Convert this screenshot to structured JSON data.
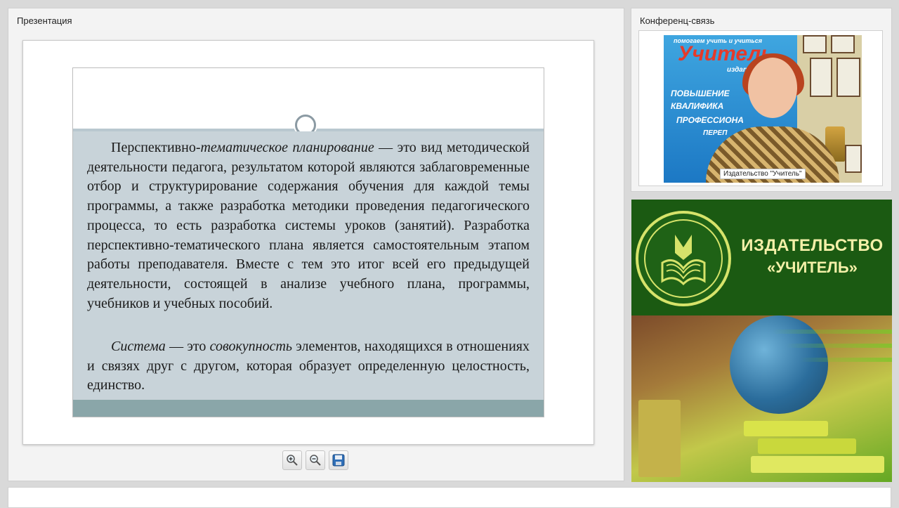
{
  "presentation": {
    "title": "Презентация",
    "slide": {
      "para1": [
        {
          "text": "Перспективно-",
          "italic": false
        },
        {
          "text": "тематическое планирование",
          "italic": true
        },
        {
          "text": " — это вид методической деятельности педагога, результатом которой являются заблаговременные отбор и структурирование содержания обучения для каждой темы программы, а также разработка методики проведения педагогического процесса, то есть разработка системы уроков (занятий). Разработка перспективно-тематического плана является самостоятельным этапом работы преподавателя. Вместе с тем это итог всей его предыдущей деятельности, состоящей в анализе учебного плана, программы, учебников и учебных пособий.",
          "italic": false
        }
      ],
      "para2": [
        {
          "text": "Система",
          "italic": true
        },
        {
          "text": " — это ",
          "italic": false
        },
        {
          "text": "совокупность",
          "italic": true
        },
        {
          "text": " элементов, находящихся в отношениях и связях друг с другом, которая образует определенную целостность, единство.",
          "italic": false
        }
      ]
    },
    "toolbar": {
      "zoom_in_icon": "zoom-in-icon",
      "zoom_out_icon": "zoom-out-icon",
      "save_icon": "save-icon"
    }
  },
  "conference": {
    "title": "Конференц-связь",
    "video_label": "Издательство \"Учитель\"",
    "banner_lines": [
      "помогаем учить и учиться",
      "Учитель",
      "издательство",
      "ПОВЫШЕНИЕ",
      "КВАЛИФИКА",
      "ПРОФЕССИОНА",
      "ПЕРЕП"
    ]
  },
  "publisher": {
    "line1": "ИЗДАТЕЛЬСТВО",
    "line2": "«УЧИТЕЛЬ»"
  },
  "colors": {
    "slide_body": "#c8d3d9",
    "slide_footer": "#8aa6a9",
    "publisher_green": "#1b5a12",
    "publisher_text": "#f4f0a8"
  }
}
